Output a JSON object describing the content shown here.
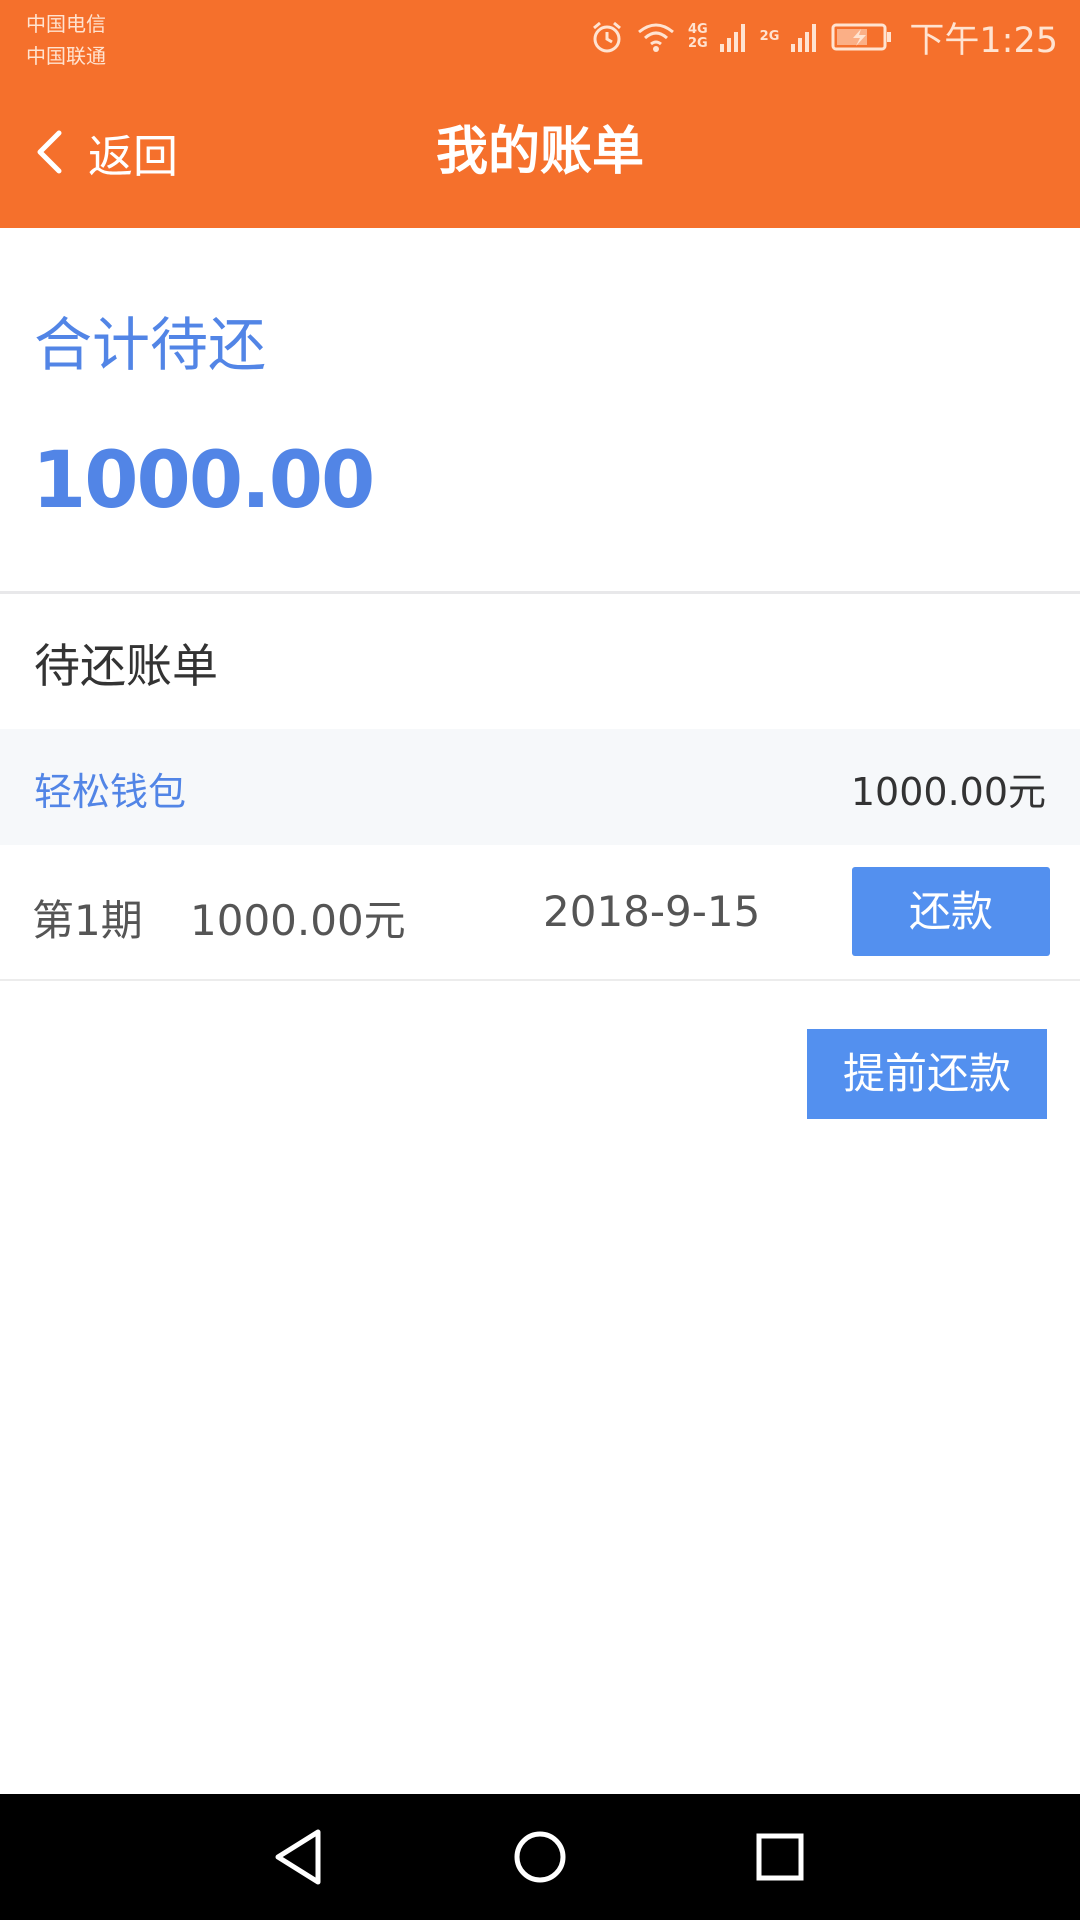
{
  "status_bar": {
    "carrier_1": "中国电信",
    "carrier_2": "中国联通",
    "net_1_top": "4G",
    "net_1_bottom": "2G",
    "net_2": "2G",
    "time": "下午1:25"
  },
  "header": {
    "back_label": "返回",
    "title": "我的账单"
  },
  "summary": {
    "label": "合计待还",
    "amount": "1000.00"
  },
  "section": {
    "title": "待还账单"
  },
  "product": {
    "name": "轻松钱包",
    "amount": "1000.00元"
  },
  "bills": [
    {
      "period": "第1期",
      "amount": "1000.00元",
      "date": "2018-9-15",
      "repay_label": "还款"
    }
  ],
  "actions": {
    "prepay_label": "提前还款"
  },
  "colors": {
    "header_bg": "#f5702c",
    "accent_blue": "#5285e6",
    "button_blue": "#5390ef",
    "row_bg": "#f6f8fa"
  },
  "icons": {
    "status": [
      "alarm-icon",
      "wifi-icon",
      "signal-icon",
      "battery-icon"
    ],
    "nav": [
      "chevron-left-icon"
    ],
    "system": [
      "back-triangle-icon",
      "home-circle-icon",
      "recents-square-icon"
    ]
  }
}
